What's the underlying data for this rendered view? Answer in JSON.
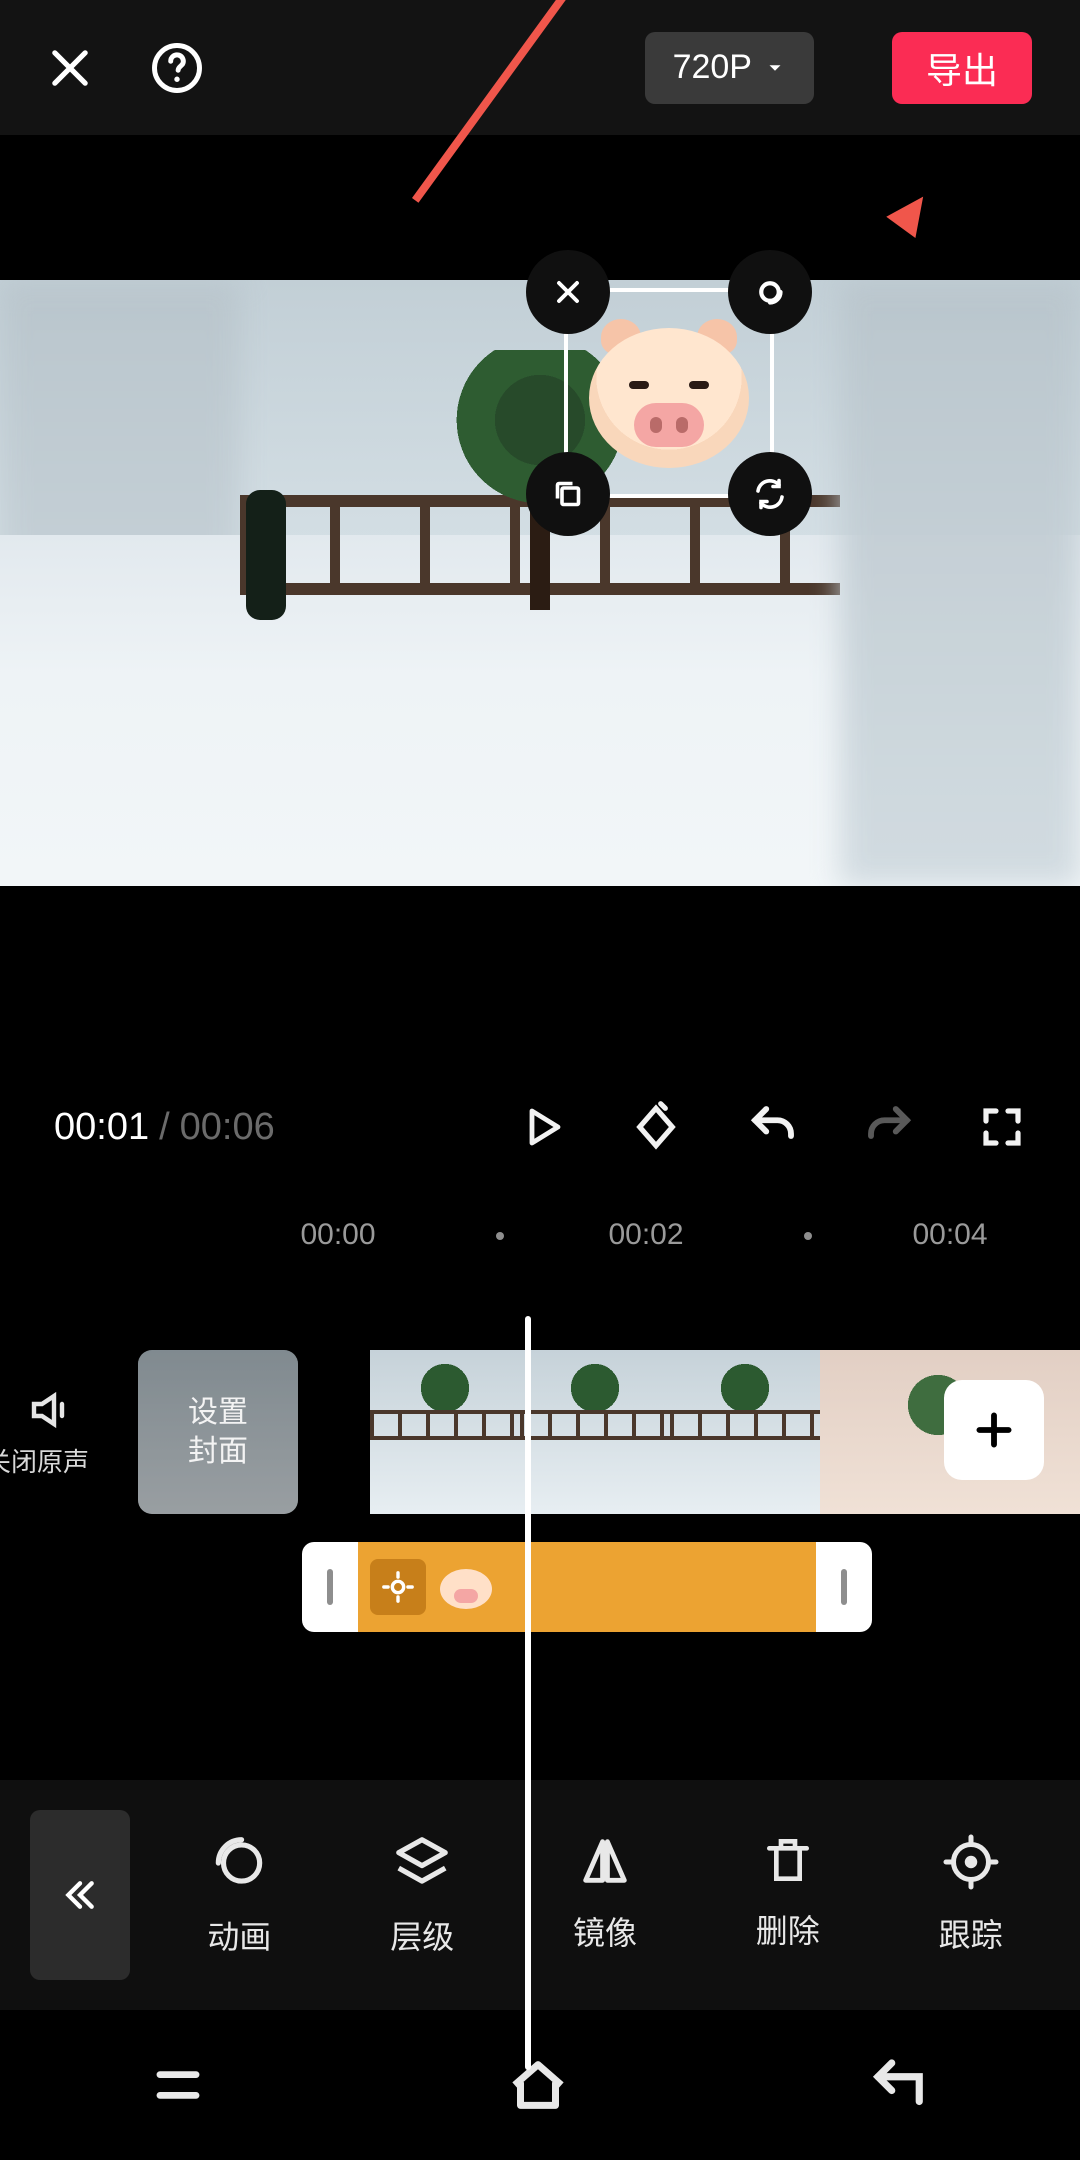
{
  "header": {
    "resolution_label": "720P",
    "export_label": "导出"
  },
  "sticker_handles": {
    "delete": "close-icon",
    "animate": "orbit-icon",
    "copy": "copy-icon",
    "rotate": "rotate-icon"
  },
  "transport": {
    "current_time": "00:01",
    "separator": "/",
    "duration": "00:06"
  },
  "ruler": {
    "marks": [
      "00:00",
      "00:02",
      "00:04"
    ]
  },
  "timeline": {
    "mute_label": "关闭原声",
    "cover_label": "设置\n封面",
    "sticker_tag_icon": "target-icon"
  },
  "toolbar": {
    "items": [
      {
        "id": "animation",
        "label": "动画"
      },
      {
        "id": "layer",
        "label": "层级"
      },
      {
        "id": "mirror",
        "label": "镜像"
      },
      {
        "id": "delete",
        "label": "删除"
      },
      {
        "id": "track",
        "label": "跟踪"
      }
    ]
  }
}
